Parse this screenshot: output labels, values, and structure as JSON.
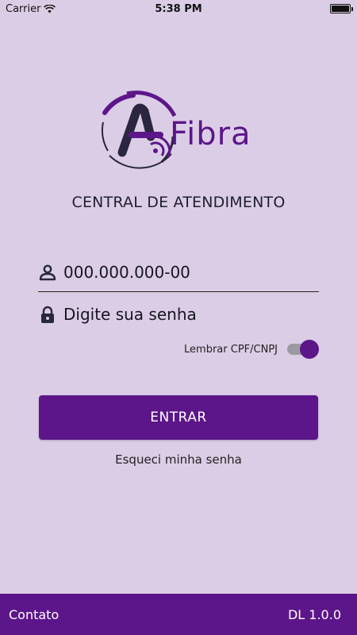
{
  "status_bar": {
    "carrier": "Carrier",
    "time": "5:38 PM",
    "icons": [
      "wifi-icon",
      "battery-icon"
    ]
  },
  "brand": {
    "logo_text": "Fibra",
    "color": "#5c1689"
  },
  "page_title": "CENTRAL DE ATENDIMENTO",
  "login_form": {
    "cpf_value": "000.000.000-00",
    "password_placeholder": "Digite sua senha",
    "remember_label": "Lembrar CPF/CNPJ",
    "remember_enabled": true,
    "submit_label": "ENTRAR",
    "forgot_label": "Esqueci minha senha",
    "icons": [
      "user-icon",
      "lock-icon"
    ]
  },
  "footer": {
    "contact_label": "Contato",
    "version": "DL 1.0.0"
  },
  "colors": {
    "background": "#dccde6",
    "accent": "#5c1689",
    "toggle_track": "#9c9aa0"
  }
}
